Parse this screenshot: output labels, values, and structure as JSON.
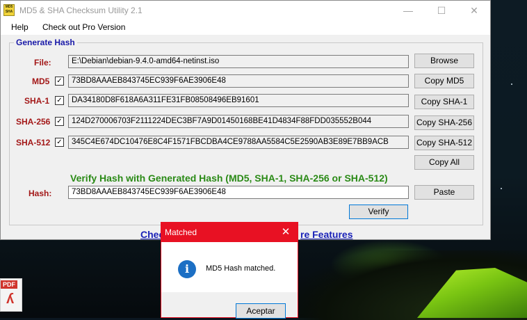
{
  "window": {
    "title": "MD5 & SHA Checksum Utility 2.1",
    "icon_text": "MD5 SHA",
    "minimize": "—",
    "maximize": "☐",
    "close": "✕"
  },
  "menu": {
    "help": "Help",
    "pro": "Check out Pro Version"
  },
  "generate": {
    "group_title": "Generate Hash",
    "file_label": "File:",
    "file_value": "E:\\Debian\\debian-9.4.0-amd64-netinst.iso",
    "browse": "Browse",
    "md5_label": "MD5",
    "md5_checked": true,
    "md5_value": "73BD8AAAEB843745EC939F6AE3906E48",
    "copy_md5": "Copy MD5",
    "sha1_label": "SHA-1",
    "sha1_checked": true,
    "sha1_value": "DA34180D8F618A6A311FE31FB08508496EB91601",
    "copy_sha1": "Copy SHA-1",
    "sha256_label": "SHA-256",
    "sha256_checked": true,
    "sha256_value": "124D270006703F2111224DEC3BF7A9D01450168BE41D4834F88FDD035552B044",
    "copy_sha256": "Copy SHA-256",
    "sha512_label": "SHA-512",
    "sha512_checked": true,
    "sha512_value": "345C4E674DC10476E8C4F1571FBCDBA4CE9788AA5584C5E2590AB3E89E7BB9ACB",
    "copy_sha512": "Copy SHA-512",
    "copy_all": "Copy All"
  },
  "verify": {
    "title": "Verify Hash with Generated Hash (MD5, SHA-1, SHA-256 or SHA-512)",
    "hash_label": "Hash:",
    "hash_value": "73BD8AAAEB843745EC939F6AE3906E48",
    "paste": "Paste",
    "verify_button": "Verify"
  },
  "links": {
    "left_fragment": "Check",
    "right_fragment": "re Features"
  },
  "dialog": {
    "title": "Matched",
    "close": "✕",
    "icon": "i",
    "message": "MD5 Hash matched.",
    "ok": "Aceptar"
  },
  "desktop": {
    "pdf_tag": "PDF",
    "pdf_glyph": "ʎ"
  },
  "colors": {
    "label_red": "#a31818",
    "group_title_blue": "#1a1aa8",
    "verify_green": "#2a8a16",
    "dialog_accent": "#e81123",
    "focus_blue": "#0078d7"
  }
}
